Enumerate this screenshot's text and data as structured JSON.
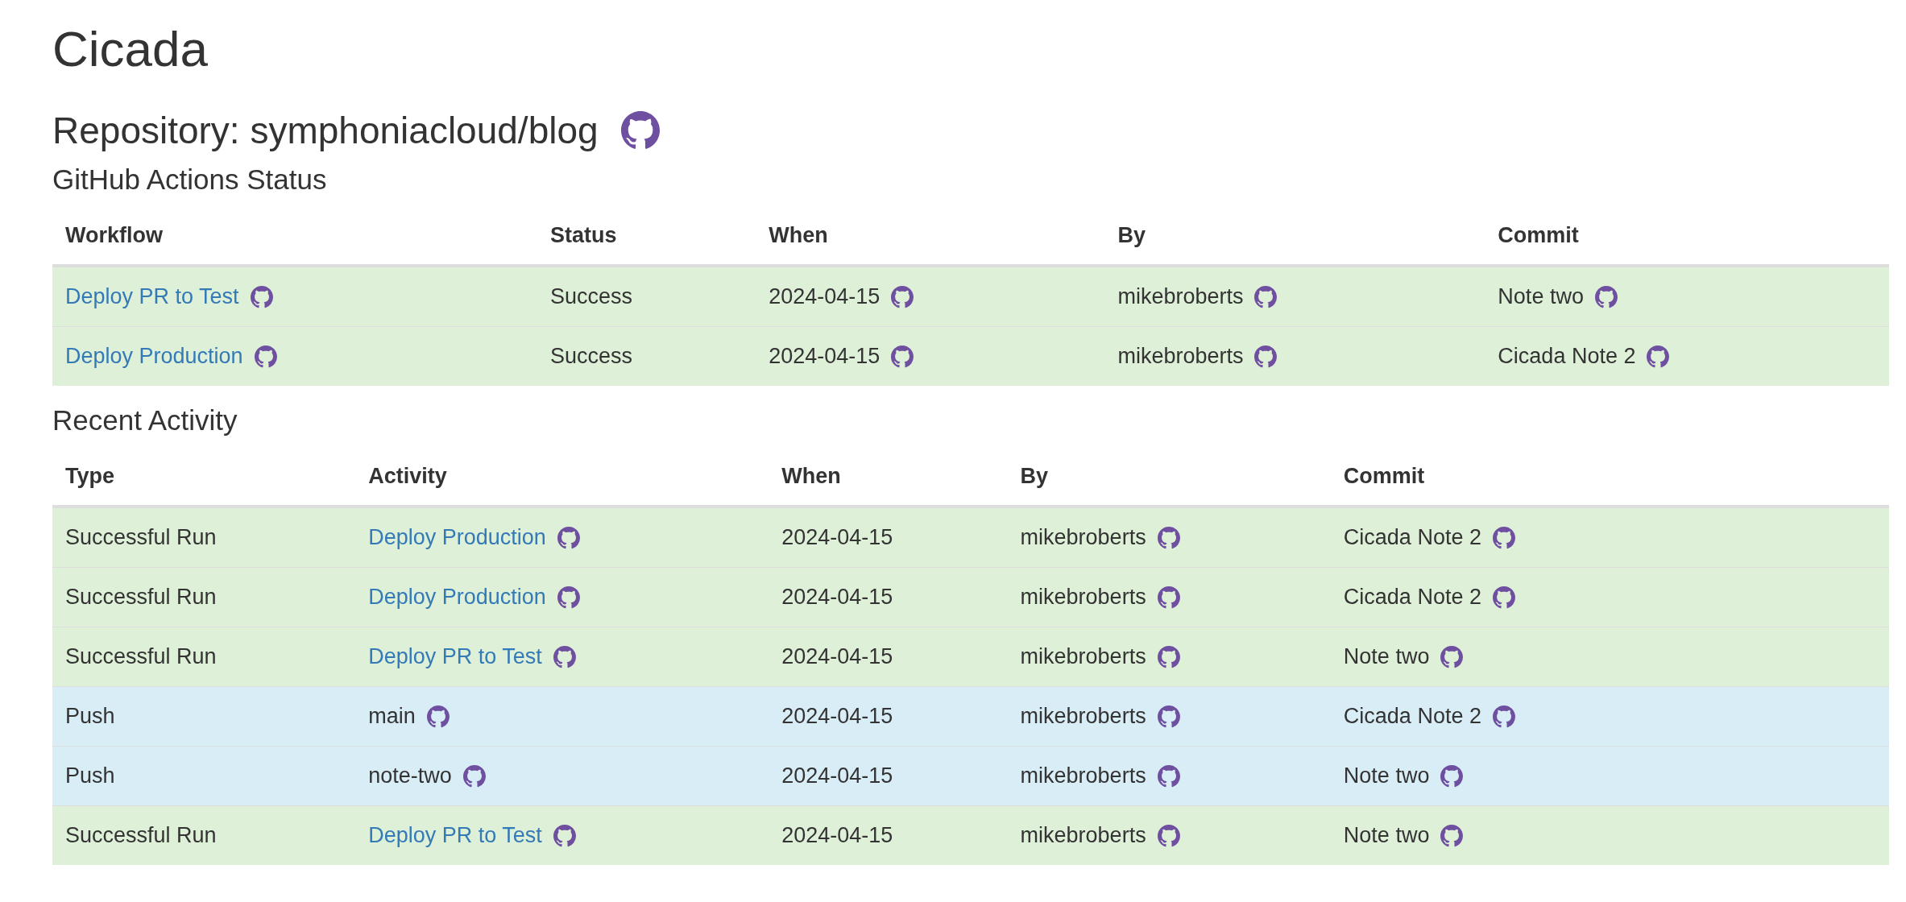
{
  "title": "Cicada",
  "repository": {
    "label": "Repository: symphoniacloud/blog"
  },
  "actions_status": {
    "heading": "GitHub Actions Status",
    "columns": [
      "Workflow",
      "Status",
      "When",
      "By",
      "Commit"
    ],
    "rows": [
      {
        "kind": "success",
        "cells": [
          {
            "text": "Deploy PR to Test",
            "link": true,
            "icon": true
          },
          {
            "text": "Success",
            "link": false,
            "icon": false
          },
          {
            "text": "2024-04-15",
            "link": false,
            "icon": true
          },
          {
            "text": "mikebroberts",
            "link": false,
            "icon": true
          },
          {
            "text": "Note two",
            "link": false,
            "icon": true
          }
        ]
      },
      {
        "kind": "success",
        "cells": [
          {
            "text": "Deploy Production",
            "link": true,
            "icon": true
          },
          {
            "text": "Success",
            "link": false,
            "icon": false
          },
          {
            "text": "2024-04-15",
            "link": false,
            "icon": true
          },
          {
            "text": "mikebroberts",
            "link": false,
            "icon": true
          },
          {
            "text": "Cicada Note 2",
            "link": false,
            "icon": true
          }
        ]
      }
    ]
  },
  "recent_activity": {
    "heading": "Recent Activity",
    "columns": [
      "Type",
      "Activity",
      "When",
      "By",
      "Commit"
    ],
    "rows": [
      {
        "kind": "success",
        "cells": [
          {
            "text": "Successful Run",
            "link": false,
            "icon": false
          },
          {
            "text": "Deploy Production",
            "link": true,
            "icon": true
          },
          {
            "text": "2024-04-15",
            "link": false,
            "icon": false
          },
          {
            "text": "mikebroberts",
            "link": false,
            "icon": true
          },
          {
            "text": "Cicada Note 2",
            "link": false,
            "icon": true
          }
        ]
      },
      {
        "kind": "success",
        "cells": [
          {
            "text": "Successful Run",
            "link": false,
            "icon": false
          },
          {
            "text": "Deploy Production",
            "link": true,
            "icon": true
          },
          {
            "text": "2024-04-15",
            "link": false,
            "icon": false
          },
          {
            "text": "mikebroberts",
            "link": false,
            "icon": true
          },
          {
            "text": "Cicada Note 2",
            "link": false,
            "icon": true
          }
        ]
      },
      {
        "kind": "success",
        "cells": [
          {
            "text": "Successful Run",
            "link": false,
            "icon": false
          },
          {
            "text": "Deploy PR to Test",
            "link": true,
            "icon": true
          },
          {
            "text": "2024-04-15",
            "link": false,
            "icon": false
          },
          {
            "text": "mikebroberts",
            "link": false,
            "icon": true
          },
          {
            "text": "Note two",
            "link": false,
            "icon": true
          }
        ]
      },
      {
        "kind": "info",
        "cells": [
          {
            "text": "Push",
            "link": false,
            "icon": false
          },
          {
            "text": "main",
            "link": false,
            "icon": true
          },
          {
            "text": "2024-04-15",
            "link": false,
            "icon": false
          },
          {
            "text": "mikebroberts",
            "link": false,
            "icon": true
          },
          {
            "text": "Cicada Note 2",
            "link": false,
            "icon": true
          }
        ]
      },
      {
        "kind": "info",
        "cells": [
          {
            "text": "Push",
            "link": false,
            "icon": false
          },
          {
            "text": "note-two",
            "link": false,
            "icon": true
          },
          {
            "text": "2024-04-15",
            "link": false,
            "icon": false
          },
          {
            "text": "mikebroberts",
            "link": false,
            "icon": true
          },
          {
            "text": "Note two",
            "link": false,
            "icon": true
          }
        ]
      },
      {
        "kind": "success",
        "cells": [
          {
            "text": "Successful Run",
            "link": false,
            "icon": false
          },
          {
            "text": "Deploy PR to Test",
            "link": true,
            "icon": true
          },
          {
            "text": "2024-04-15",
            "link": false,
            "icon": false
          },
          {
            "text": "mikebroberts",
            "link": false,
            "icon": true
          },
          {
            "text": "Note two",
            "link": false,
            "icon": true
          }
        ]
      }
    ]
  }
}
